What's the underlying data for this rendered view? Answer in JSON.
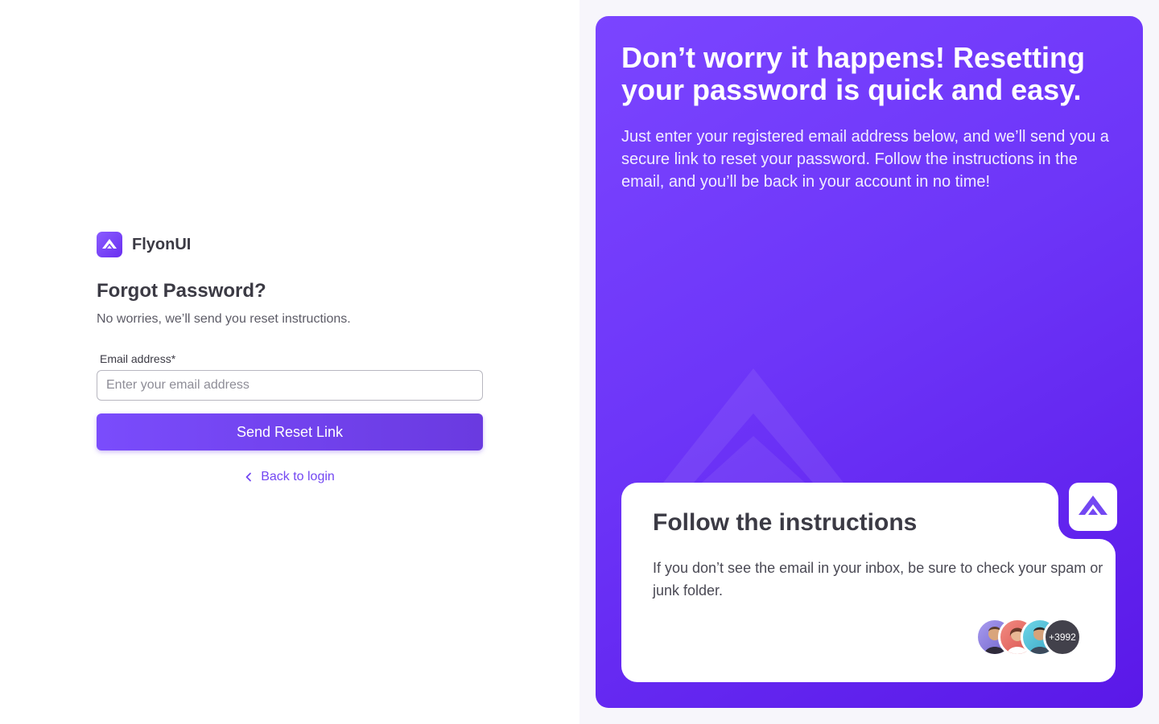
{
  "brand": {
    "name": "FlyonUI",
    "logo_icon": "flyonui-logo-icon"
  },
  "form": {
    "title": "Forgot Password?",
    "subtitle": "No worries, we’ll send you reset instructions.",
    "email_label": "Email address*",
    "email_placeholder": "Enter your email address",
    "email_value": "",
    "submit_label": "Send Reset Link",
    "back_label": "Back to login",
    "back_icon": "chevron-left-icon"
  },
  "hero": {
    "title": "Don’t worry it happens! Resetting your password is quick and easy.",
    "description": "Just enter your registered email address below, and we’ll send you a secure link to reset your password. Follow the instructions in the email, and you’ll be back in your account in no time!",
    "card": {
      "title": "Follow the instructions",
      "text": "If you don’t see the email in your inbox, be sure to check your spam or junk folder.",
      "avatars_more": "+3992"
    }
  },
  "colors": {
    "accent": "#7347f2",
    "hero_start": "#7b45ff",
    "hero_end": "#5a18e8",
    "text": "#3b3a44"
  }
}
